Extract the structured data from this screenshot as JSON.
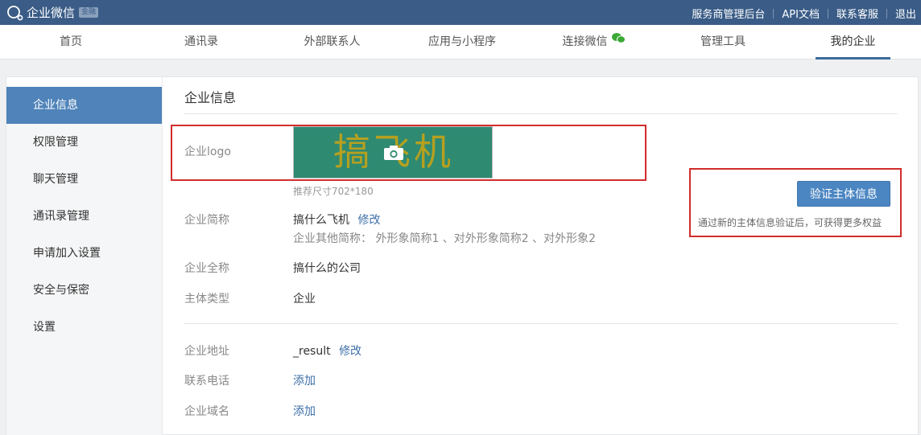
{
  "topbar": {
    "brand": "企业微信",
    "badge": "金融",
    "links": [
      "服务商管理后台",
      "API文档",
      "联系客服",
      "退出"
    ]
  },
  "nav": {
    "items": [
      "首页",
      "通讯录",
      "外部联系人",
      "应用与小程序",
      "连接微信",
      "管理工具",
      "我的企业"
    ],
    "active": "我的企业"
  },
  "sidebar": {
    "items": [
      "企业信息",
      "权限管理",
      "聊天管理",
      "通讯录管理",
      "申请加入设置",
      "安全与保密",
      "设置"
    ],
    "active": "企业信息"
  },
  "main": {
    "title": "企业信息",
    "logo": {
      "label": "企业logo",
      "image_text": "搞飞机",
      "hint": "推荐尺寸702*180"
    },
    "short_name": {
      "label": "企业简称",
      "value": "搞什么飞机",
      "edit": "修改",
      "others": "企业其他简称：  外形象简称1 、对外形象简称2 、对外形象2"
    },
    "full_name": {
      "label": "企业全称",
      "value": "搞什么的公司"
    },
    "entity_type": {
      "label": "主体类型",
      "value": "企业"
    },
    "verify": {
      "button": "验证主体信息",
      "tip": "通过新的主体信息验证后，可获得更多权益"
    },
    "address": {
      "label": "企业地址",
      "value": "_result",
      "edit": "修改"
    },
    "phone": {
      "label": "联系电话",
      "action": "添加"
    },
    "domain": {
      "label": "企业域名",
      "action": "添加"
    }
  },
  "colors": {
    "topbar": "#3a5c87",
    "accent": "#4f83b9",
    "link": "#3d6fa8",
    "highlight_border": "#d22c2c",
    "logo_bg": "#2f8a72",
    "logo_text": "#b5a020"
  }
}
